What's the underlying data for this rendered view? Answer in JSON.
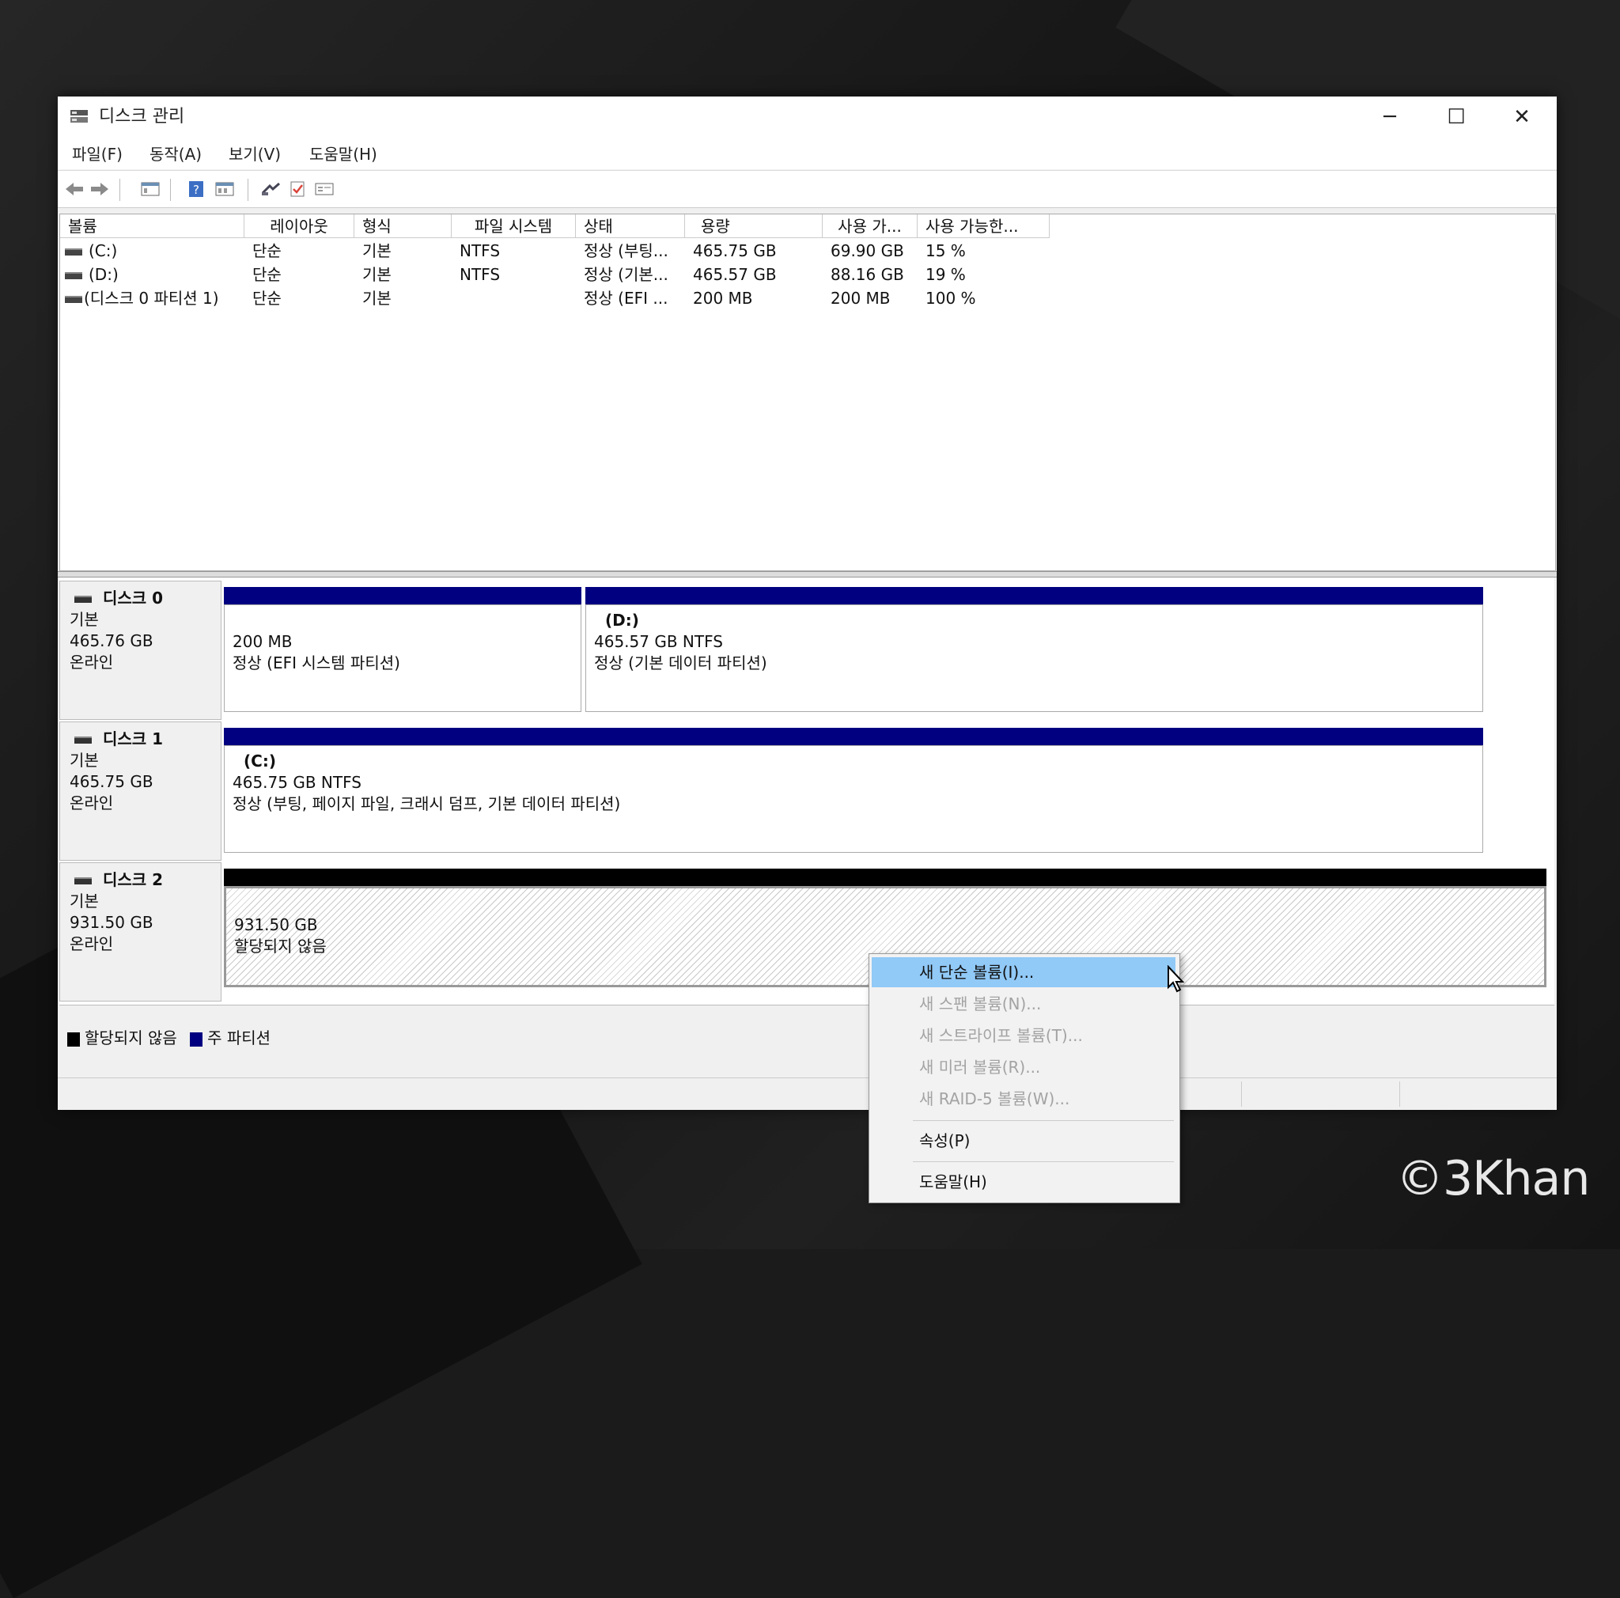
{
  "window": {
    "title": "디스크 관리",
    "controls": {
      "minimize": "─",
      "maximize": "☐",
      "close": "✕"
    }
  },
  "menu": [
    "파일(F)",
    "동작(A)",
    "보기(V)",
    "도움말(H)"
  ],
  "toolbar_icons": [
    "back-icon",
    "forward-icon",
    "console-icon",
    "help-icon",
    "view-icon",
    "connect-icon",
    "check-icon",
    "properties-icon"
  ],
  "volume_table": {
    "columns": [
      "볼륨",
      "레이아웃",
      "형식",
      "파일 시스템",
      "상태",
      "용량",
      "사용 가...",
      "사용 가능한..."
    ],
    "rows": [
      [
        "(C:)",
        "단순",
        "기본",
        "NTFS",
        "정상 (부팅...",
        "465.75 GB",
        "69.90 GB",
        "15 %"
      ],
      [
        "(D:)",
        "단순",
        "기본",
        "NTFS",
        "정상 (기본...",
        "465.57 GB",
        "88.16 GB",
        "19 %"
      ],
      [
        "(디스크 0 파티션 1)",
        "단순",
        "기본",
        "",
        "정상 (EFI ...",
        "200 MB",
        "200 MB",
        "100 %"
      ]
    ]
  },
  "disks": [
    {
      "name": "디스크 0",
      "type": "기본",
      "size": "465.76 GB",
      "status": "온라인",
      "partitions": [
        {
          "name": "",
          "line1": "200 MB",
          "line2": "정상 (EFI 시스템 파티션)"
        },
        {
          "name": "(D:)",
          "line1": "465.57 GB NTFS",
          "line2": "정상 (기본 데이터 파티션)"
        }
      ]
    },
    {
      "name": "디스크 1",
      "type": "기본",
      "size": "465.75 GB",
      "status": "온라인",
      "partitions": [
        {
          "name": "(C:)",
          "line1": "465.75 GB NTFS",
          "line2": "정상 (부팅, 페이지 파일, 크래시 덤프, 기본 데이터 파티션)"
        }
      ]
    },
    {
      "name": "디스크 2",
      "type": "기본",
      "size": "931.50 GB",
      "status": "온라인",
      "partitions": [
        {
          "name": "",
          "line1": "931.50 GB",
          "line2": "할당되지 않음"
        }
      ]
    }
  ],
  "legend": [
    {
      "label": "할당되지 않음",
      "color": "#000000"
    },
    {
      "label": "주 파티션",
      "color": "#000080"
    }
  ],
  "context_menu": {
    "items": [
      {
        "label": "새 단순 볼륨(I)...",
        "state": "highlighted"
      },
      {
        "label": "새 스팬 볼륨(N)...",
        "state": "disabled"
      },
      {
        "label": "새 스트라이프 볼륨(T)...",
        "state": "disabled"
      },
      {
        "label": "새 미러 볼륨(R)...",
        "state": "disabled"
      },
      {
        "label": "새 RAID-5 볼륨(W)...",
        "state": "disabled"
      },
      {
        "label": "속성(P)",
        "state": "enabled"
      },
      {
        "label": "도움말(H)",
        "state": "enabled"
      }
    ]
  },
  "colors": {
    "primary_partition": "#000080",
    "unallocated": "#000000",
    "menu_highlight": "#91c9f7"
  },
  "watermark": "©3Khan"
}
